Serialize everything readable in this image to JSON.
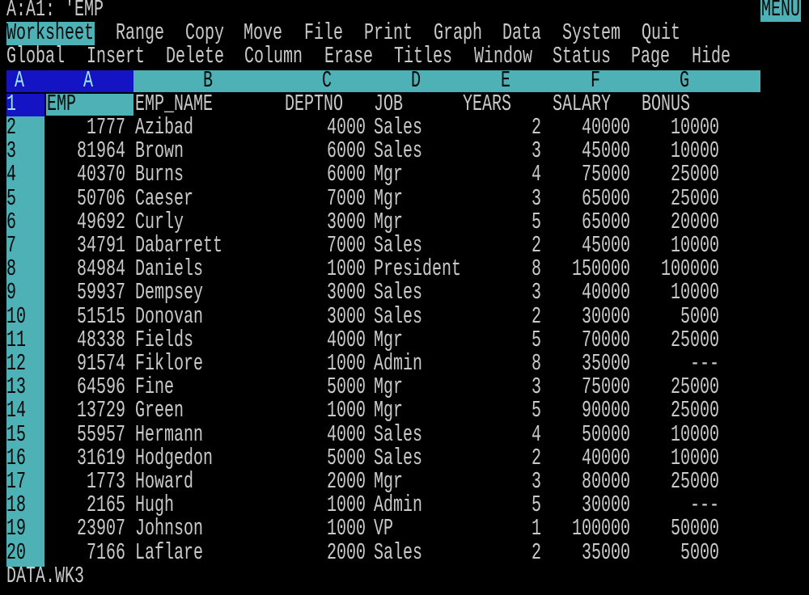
{
  "status_line": {
    "cell_ref": "A:A1: 'EMP",
    "mode_indicator": "MENU"
  },
  "main_menu": [
    "Worksheet",
    "Range",
    "Copy",
    "Move",
    "File",
    "Print",
    "Graph",
    "Data",
    "System",
    "Quit"
  ],
  "main_menu_selected": "Worksheet",
  "submenu": [
    "Global",
    "Insert",
    "Delete",
    "Column",
    "Erase",
    "Titles",
    "Window",
    "Status",
    "Page",
    "Hide"
  ],
  "sheet_letter": "A",
  "column_headers": [
    "A",
    "B",
    "C",
    "D",
    "E",
    "F",
    "G"
  ],
  "header_row": {
    "row": "1",
    "cells": [
      "EMP",
      "EMP_NAME",
      "DEPTNO",
      "JOB",
      "YEARS",
      "SALARY",
      "BONUS"
    ]
  },
  "rows": [
    {
      "row": "2",
      "cells": [
        "1777",
        "Azibad",
        "4000",
        "Sales",
        "2",
        "40000",
        "10000"
      ]
    },
    {
      "row": "3",
      "cells": [
        "81964",
        "Brown",
        "6000",
        "Sales",
        "3",
        "45000",
        "10000"
      ]
    },
    {
      "row": "4",
      "cells": [
        "40370",
        "Burns",
        "6000",
        "Mgr",
        "4",
        "75000",
        "25000"
      ]
    },
    {
      "row": "5",
      "cells": [
        "50706",
        "Caeser",
        "7000",
        "Mgr",
        "3",
        "65000",
        "25000"
      ]
    },
    {
      "row": "6",
      "cells": [
        "49692",
        "Curly",
        "3000",
        "Mgr",
        "5",
        "65000",
        "20000"
      ]
    },
    {
      "row": "7",
      "cells": [
        "34791",
        "Dabarrett",
        "7000",
        "Sales",
        "2",
        "45000",
        "10000"
      ]
    },
    {
      "row": "8",
      "cells": [
        "84984",
        "Daniels",
        "1000",
        "President",
        "8",
        "150000",
        "100000"
      ]
    },
    {
      "row": "9",
      "cells": [
        "59937",
        "Dempsey",
        "3000",
        "Sales",
        "3",
        "40000",
        "10000"
      ]
    },
    {
      "row": "10",
      "cells": [
        "51515",
        "Donovan",
        "3000",
        "Sales",
        "2",
        "30000",
        "5000"
      ]
    },
    {
      "row": "11",
      "cells": [
        "48338",
        "Fields",
        "4000",
        "Mgr",
        "5",
        "70000",
        "25000"
      ]
    },
    {
      "row": "12",
      "cells": [
        "91574",
        "Fiklore",
        "1000",
        "Admin",
        "8",
        "35000",
        "---"
      ]
    },
    {
      "row": "13",
      "cells": [
        "64596",
        "Fine",
        "5000",
        "Mgr",
        "3",
        "75000",
        "25000"
      ]
    },
    {
      "row": "14",
      "cells": [
        "13729",
        "Green",
        "1000",
        "Mgr",
        "5",
        "90000",
        "25000"
      ]
    },
    {
      "row": "15",
      "cells": [
        "55957",
        "Hermann",
        "4000",
        "Sales",
        "4",
        "50000",
        "10000"
      ]
    },
    {
      "row": "16",
      "cells": [
        "31619",
        "Hodgedon",
        "5000",
        "Sales",
        "2",
        "40000",
        "10000"
      ]
    },
    {
      "row": "17",
      "cells": [
        "1773",
        "Howard",
        "2000",
        "Mgr",
        "3",
        "80000",
        "25000"
      ]
    },
    {
      "row": "18",
      "cells": [
        "2165",
        "Hugh",
        "1000",
        "Admin",
        "5",
        "30000",
        "---"
      ]
    },
    {
      "row": "19",
      "cells": [
        "23907",
        "Johnson",
        "1000",
        "VP",
        "1",
        "100000",
        "50000"
      ]
    },
    {
      "row": "20",
      "cells": [
        "7166",
        "Laflare",
        "2000",
        "Sales",
        "2",
        "35000",
        "5000"
      ]
    }
  ],
  "file_name": "DATA.WK3",
  "colors": {
    "highlight": "#4db1b6",
    "selected_column": "#1414c4",
    "text": "#c9c9c9",
    "background": "#000000"
  }
}
